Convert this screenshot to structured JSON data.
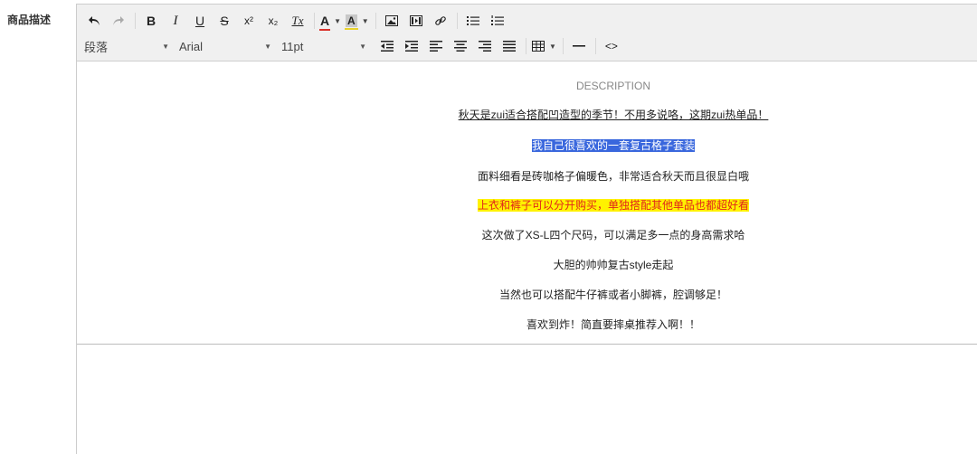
{
  "field": {
    "label": "商品描述"
  },
  "toolbar": {
    "block_format": "段落",
    "font_family": "Arial",
    "font_size": "11pt",
    "icons": {
      "undo": "undo-icon",
      "redo": "redo-icon",
      "bold": "B",
      "italic": "I",
      "underline": "U",
      "strikethrough": "S",
      "superscript": "x²",
      "subscript": "x₂",
      "clear_format": "Tx",
      "text_color": "A",
      "bg_color": "A",
      "image": "image-icon",
      "media": "media-icon",
      "link": "link-icon",
      "bullet_list": "bullet-list-icon",
      "numbered_list": "numbered-list-icon",
      "outdent": "outdent-icon",
      "indent": "indent-icon",
      "align_left": "align-left-icon",
      "align_center": "align-center-icon",
      "align_right": "align-right-icon",
      "justify": "justify-icon",
      "table": "table-icon",
      "hr": "horizontal-rule-icon",
      "code": "<>"
    },
    "colors": {
      "text_color_bar": "#d9322b",
      "bg_color_bar": "#e8d22b"
    }
  },
  "content": {
    "heading": "DESCRIPTION",
    "lines": [
      "秋天是zui适合搭配凹造型的季节！不用多说咯，这期zui热单品！",
      "我自己很喜欢的一套复古格子套装",
      "面料细看是砖咖格子偏暖色，非常适合秋天而且很显白哦",
      "上衣和裤子可以分开购买，单独搭配其他单品也都超好看",
      "这次做了XS-L四个尺码，可以满足多一点的身高需求哈",
      "大胆的帅帅复古style走起",
      "当然也可以搭配牛仔裤或者小脚裤，腔调够足！",
      "喜欢到炸！简直要摔桌推荐入啊！！"
    ],
    "colors": {
      "selection": "#3967dd",
      "highlight_bg": "#fff200",
      "highlight_text": "#e1251b"
    }
  }
}
